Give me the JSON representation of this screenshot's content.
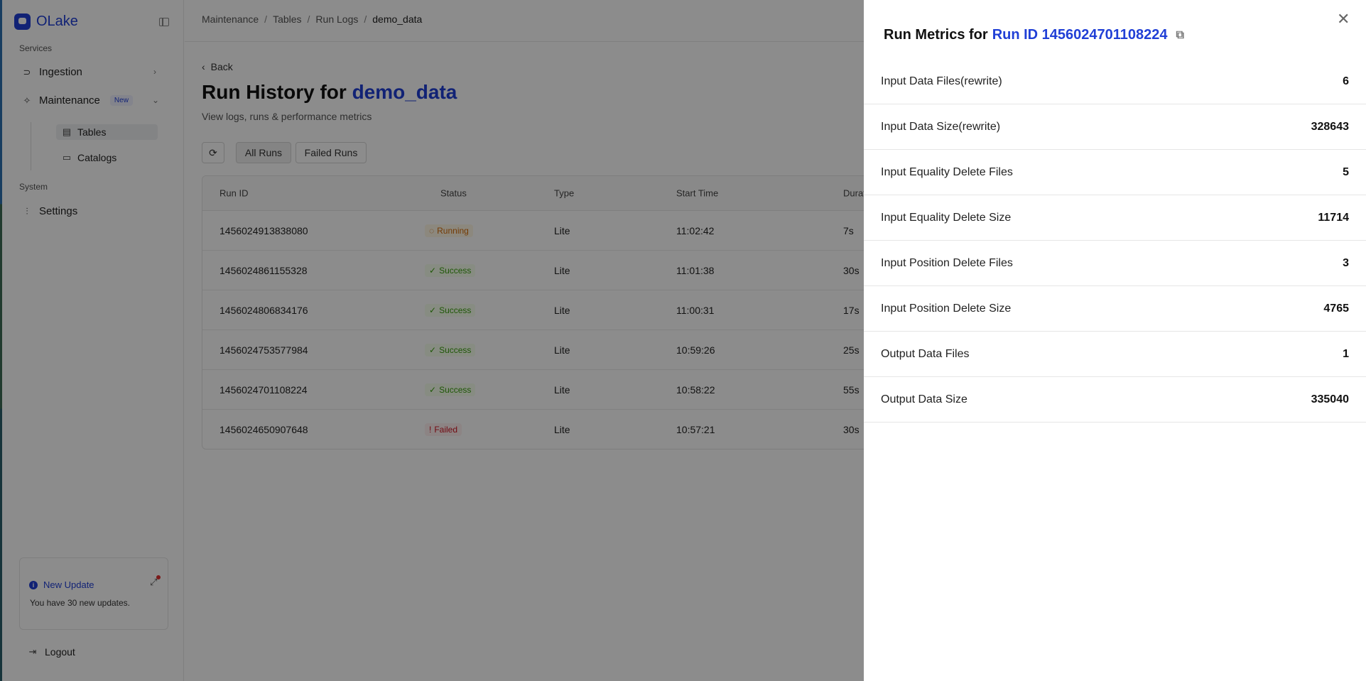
{
  "sidebar": {
    "logo": "OLake",
    "services_label": "Services",
    "system_label": "System",
    "items": {
      "ingestion": "Ingestion",
      "maintenance": "Maintenance",
      "maintenance_badge": "New",
      "tables": "Tables",
      "catalogs": "Catalogs",
      "settings": "Settings"
    },
    "update": {
      "title": "New Update",
      "text": "You have 30 new updates."
    },
    "logout": "Logout"
  },
  "breadcrumb": [
    "Maintenance",
    "Tables",
    "Run Logs",
    "demo_data"
  ],
  "back_label": "Back",
  "page": {
    "title_prefix": "Run History for",
    "title_accent": "demo_data",
    "subtitle": "View logs, runs & performance metrics"
  },
  "toolbar": {
    "all_runs": "All Runs",
    "failed_runs": "Failed Runs"
  },
  "table": {
    "columns": [
      "Run ID",
      "Status",
      "Type",
      "Start Time",
      "Durat"
    ],
    "rows": [
      {
        "id": "1456024913838080",
        "status": "Running",
        "type": "Lite",
        "start": "11:02:42",
        "duration": "7s"
      },
      {
        "id": "1456024861155328",
        "status": "Success",
        "type": "Lite",
        "start": "11:01:38",
        "duration": "30s"
      },
      {
        "id": "1456024806834176",
        "status": "Success",
        "type": "Lite",
        "start": "11:00:31",
        "duration": "17s"
      },
      {
        "id": "1456024753577984",
        "status": "Success",
        "type": "Lite",
        "start": "10:59:26",
        "duration": "25s"
      },
      {
        "id": "1456024701108224",
        "status": "Success",
        "type": "Lite",
        "start": "10:58:22",
        "duration": "55s"
      },
      {
        "id": "1456024650907648",
        "status": "Failed",
        "type": "Lite",
        "start": "10:57:21",
        "duration": "30s"
      }
    ]
  },
  "drawer": {
    "title_prefix": "Run Metrics for",
    "title_accent": "Run ID 1456024701108224",
    "metrics": [
      {
        "label": "Input Data Files(rewrite)",
        "value": "6"
      },
      {
        "label": "Input Data Size(rewrite)",
        "value": "328643"
      },
      {
        "label": "Input Equality Delete Files",
        "value": "5"
      },
      {
        "label": "Input Equality Delete Size",
        "value": "11714"
      },
      {
        "label": "Input Position Delete Files",
        "value": "3"
      },
      {
        "label": "Input Position Delete Size",
        "value": "4765"
      },
      {
        "label": "Output Data Files",
        "value": "1"
      },
      {
        "label": "Output Data Size",
        "value": "335040"
      }
    ]
  },
  "colors": {
    "accent": "#203fd6",
    "running": "#d46b08",
    "success": "#389e0d",
    "failed": "#cf1322"
  }
}
